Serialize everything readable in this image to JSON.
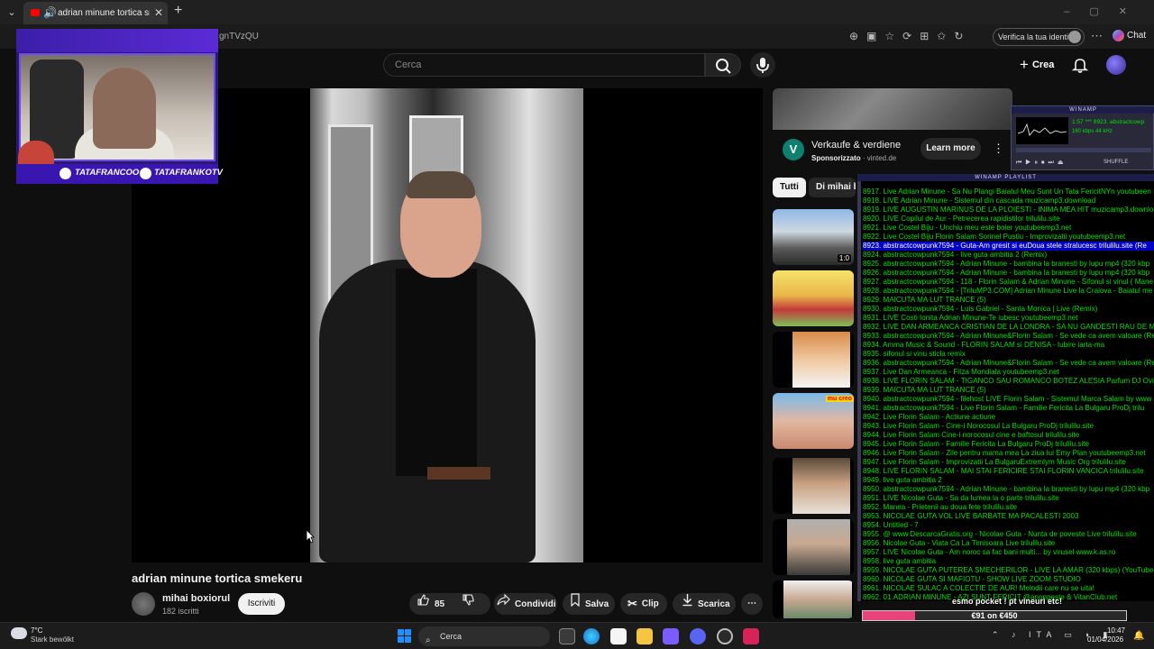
{
  "browser": {
    "tab_title": "adrian minune tortica smekeru",
    "url_partial": "gnTVzQU",
    "verify_label": "Verifica la tua identità",
    "chat_label": "Chat"
  },
  "youtube_header": {
    "search_placeholder": "Cerca",
    "create_label": "Crea"
  },
  "overlay": {
    "handle_instagram": "TATAFRANCOO",
    "handle_tiktok": "TATAFRANKOTV"
  },
  "video": {
    "title": "adrian minune tortica smekeru",
    "channel_name": "mihai boxiorul",
    "subscribers": "182 iscritti",
    "subscribe_label": "Iscriviti",
    "likes": "85",
    "share_label": "Condividi",
    "save_label": "Salva",
    "clip_label": "Clip",
    "download_label": "Scarica"
  },
  "ad": {
    "logo_letter": "V",
    "title": "Verkaufe & verdiene",
    "sponsored_label": "Sponsorizzato",
    "domain": "vinted.de",
    "learn_more": "Learn more"
  },
  "chips": {
    "all": "Tutti",
    "other": "Di mihai b"
  },
  "recommendations": {
    "first_duration": "1:0",
    "third_caption": "mu creo"
  },
  "winamp": {
    "title": "WINAMP",
    "time": "1:57",
    "track_info": "*** 8923. abstractcowp",
    "kbps": "160",
    "khz": "44",
    "shuffle": "SHUFFLE",
    "playlist_title": "WINAMP PLAYLIST",
    "selected_index": 6,
    "rows": [
      "8917. Live Adrian Minune - Sa Nu Plangi Baiatul Meu  Sunt Un Tata FericitNYn youtubeen",
      "8918. LIVE Adrian Minune - Sistemul din cascada muzicamp3.download",
      "8919. LIVE AUGUSTIN  MARINUS DE LA PLOIESTI - INIMA MEA HIT muzicamp3.download",
      "8920. LIVE Copilul de Aur - Petrecerea rapidistilor trilulilu.site",
      "8921. Live Costel Biju - Unchiu meu este boier youtubeemp3.net",
      "8922. Live Costel Biju Florin Salam  Sorinel Pustiu - Improvizatii youtubeemp3.net",
      "8923. abstractcowpunk7594 - Guta-Am gresit si euDoua stele stralucesc trilulilu.site (Re",
      "8924. abstractcowpunk7594 - live guta ambitia 2 (Remix)",
      "8925. abstractcowpunk7594 - Adrian Minune -  bambina la branesti by lupu mp4 (320 kbp",
      "8926. abstractcowpunk7594 - Adrian Minune -  bambina la branesti by lupu mp4 (320 kbp",
      "8927. abstractcowpunk7594 - 118 - Florin Salam & Adrian Minune - Sifonul si vinul ( Mane",
      "8928. abstractcowpunk7594 - [TriluMP3.COM] Adrian Minune Live la Craiova - Baiatul me",
      "8929. MAICUTA MA LUT TRANCE (5)",
      "8930. abstractcowpunk7594 - Luis Gabriel - Santa Monica  |  Live (Remix)",
      "8931. LIVE Costi Ionita  Adrian Minune-Te iubesc youtubeemp3.net",
      "8932. LIVE DAN ARMEANCA  CRISTIAN DE LA LONDRA - SA NU GANDESTI RAU DE MINE",
      "8933. abstractcowpunk7594 - Adrian Minune&Florin Salam - Se vede ca avem valoare (Re",
      "8934. Amma Music & Sound - FLORIN SALAM si DENISA - Iubire iarta-ma",
      "8935. sifonul si vinu sticla remix",
      "8936. abstractcowpunk7594 - Adrian Minune&Florin Salam - Se vede ca avem valoare (Re",
      "8937. Live Dan Armeanca - Fitza Mondiala youtubeemp3.net",
      "8938. LIVE FLORIN SALAM  -  TIGANCO SAU ROMANCO   BOTEZ ALESIA Parfum DJ Ovi r",
      "8939. MAICUTA MA LUT TRANCE (5)",
      "8940. abstractcowpunk7594 - filehost LIVE Florin Salam - Sistemul Marca Salam by www",
      "8941. abstractcowpunk7594 - Live Florin Salam - Familie Fericita La Bulgaru    ProDj trilu",
      "8942. Live Florin Salam - Actiune actiune",
      "8943. Live Florin Salam - Cine-i Norocosul La Bulgaru    ProDj trilulilu.site",
      "8944. Live Florin Salam  Cine-i norocosul cine e baftosul trilulilu.site",
      "8945. Live Florin Salam - Familie Fericita La Bulgaru    ProDj trilulilu.site",
      "8946. Live Florin Salam - Zile pentru mama mea La ziua lui Emy Plan youtubeemp3.net",
      "8947. Live Florin Salam - Improvizatii La BulgaruExtremlym Music Org trilulilu.site",
      "8948. LIVE FLORIN SALAM - MAI STAI FERICIRE STAI  FLORIN VANCICA trilulilu.site",
      "8949. live guta ambitia 2",
      "8950. abstractcowpunk7594 - Adrian Minune -  bambina la branesti by lupu mp4 (320 kbp",
      "8951. LIVE Nicolae Guta - Sa da lumea la o parte trilulilu.site",
      "8952. Manea - Prietenii au doua fete trilulilu.site",
      "8953. NICOLAE GUTA  VOL LIVE BARBATE MA PACALESTI 2003",
      "8954. Untitled - 7",
      "8955. @ www.DescarcaGratis.org - Nicolae Guta - Nunta de poveste Live trilulilu.site",
      "8956. Nicolae Guta - Viata Ca La Timisoara  Live trilulilu.site",
      "8957. LIVE Nicolae Guta - Am noroc sa fac bani multi... by virusel www.k.as.ro",
      "8958. live guta ambitia",
      "8959. NICOLAE GUTA PUTEREA SMECHERILOR - LIVE LA AMAR (320  kbps) (YouTube4",
      "8960. NICOLAE GUTA SI MAFIOTU - SHOW LIVE ZOOM STUDIO",
      "8961. NICOLAE SULAC A COLECTIE DE AUR! Melodii care nu se uita!",
      "8962. 01.ADRIAN MINUNE - AZI SUNT FERICIT @anonpeste & VitanClub.net"
    ]
  },
  "donation": {
    "text": "esmo pocket ! pt vineuri etc!",
    "progress_label": "€91 on €450",
    "progress_fraction": 0.2
  },
  "taskbar": {
    "temperature": "7°C",
    "weather": "Stark bewölkt",
    "search_label": "Cerca",
    "language": "ITA",
    "time": "10:47",
    "date": "01/04/2026"
  },
  "colors": {
    "youtube_bg": "#0f0f0f",
    "overlay_purple": "#5b2bd6",
    "winamp_text": "#00e000",
    "winamp_selected": "#0000c6",
    "donation_fill": "#e8437a"
  }
}
